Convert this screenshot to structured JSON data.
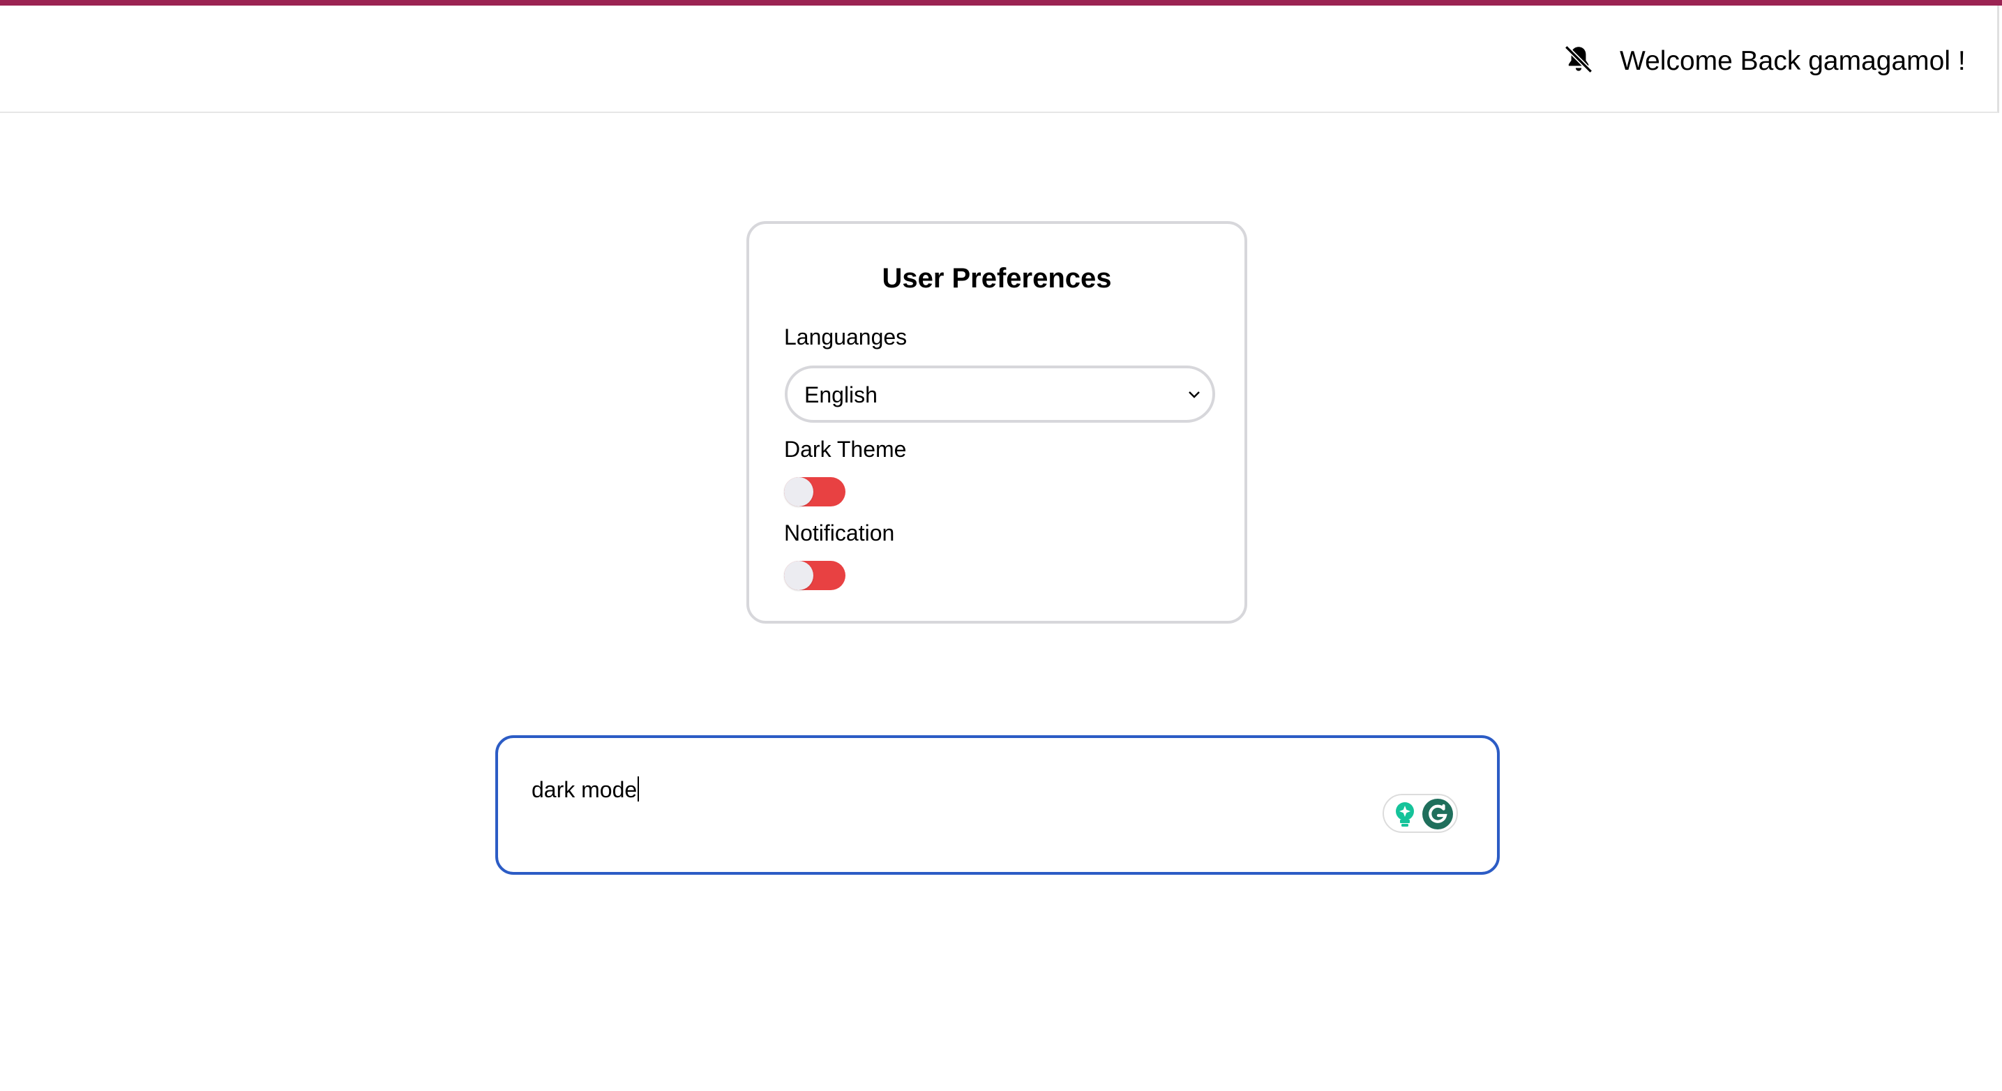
{
  "header": {
    "welcome_text": "Welcome Back gamagamol !",
    "notification_icon": "bell-slash-icon"
  },
  "preferences": {
    "title": "User Preferences",
    "language_label": "Languanges",
    "language_value": "English",
    "dark_theme_label": "Dark Theme",
    "dark_theme_on": false,
    "notification_label": "Notification",
    "notification_on": false
  },
  "editor": {
    "value": "dark mode",
    "grammarly_icons": [
      "grammarly-suggestion-icon",
      "grammarly-logo-icon"
    ]
  },
  "colors": {
    "accent_bar": "#9b2352",
    "toggle_track": "#e84142",
    "textarea_focus": "#2c5cc5",
    "grammarly_green": "#15c39a"
  }
}
